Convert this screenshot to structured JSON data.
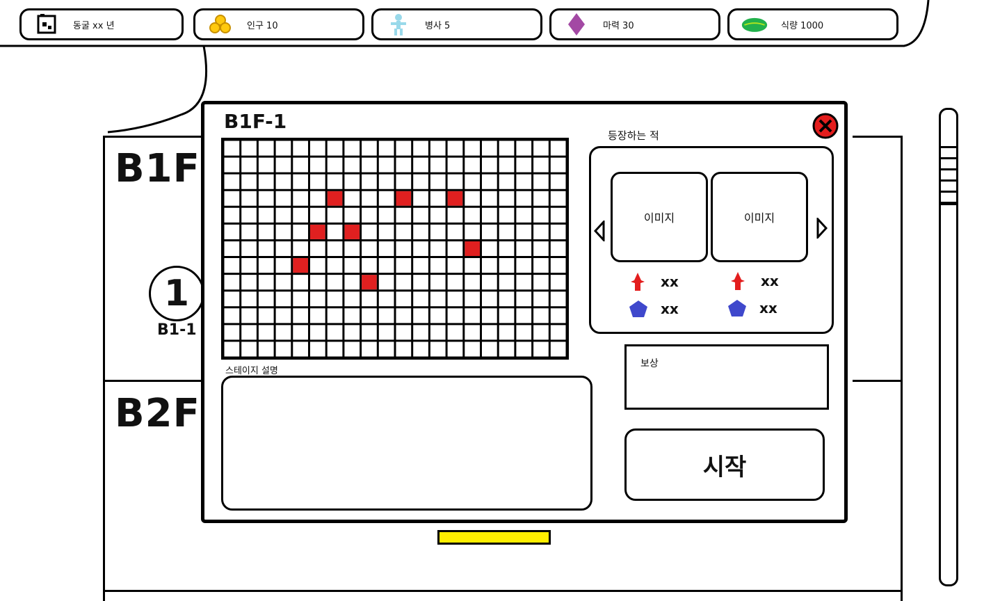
{
  "resources": [
    {
      "icon": "cave-icon",
      "label": "동굴 xx 년"
    },
    {
      "icon": "coins-icon",
      "label": "인구 10"
    },
    {
      "icon": "soldier-icon",
      "label": "병사 5"
    },
    {
      "icon": "mana-gem-icon",
      "label": "마력  30"
    },
    {
      "icon": "leaf-icon",
      "label": "식량 1000"
    }
  ],
  "floors": [
    {
      "label": "B1F"
    },
    {
      "label": "B2F"
    }
  ],
  "stage_marker": {
    "number": "1",
    "label": "B1-1"
  },
  "modal": {
    "title": "B1F-1",
    "grid": {
      "cols": 20,
      "rows": 13,
      "marked_cells": [
        [
          6,
          3
        ],
        [
          10,
          3
        ],
        [
          13,
          3
        ],
        [
          5,
          5
        ],
        [
          7,
          5
        ],
        [
          14,
          6
        ],
        [
          4,
          7
        ],
        [
          8,
          8
        ]
      ],
      "marked_color": "#e02020"
    },
    "enemies_label": "등장하는 적",
    "enemy_cards": [
      {
        "image_label": "이미지",
        "attack": "xx",
        "defense": "xx"
      },
      {
        "image_label": "이미지",
        "attack": "xx",
        "defense": "xx"
      }
    ],
    "description_label": "스테이지 설명",
    "reward_label": "보상",
    "start_label": "시작"
  },
  "colors": {
    "attack": "#e31d1d",
    "defense": "#3f48cc",
    "close": "#e31d1d",
    "highlight": "#ffee00",
    "gem": "#a349a4",
    "leaf": "#22b14c",
    "coin": "#ffc90e",
    "soldier": "#99d9ea"
  }
}
